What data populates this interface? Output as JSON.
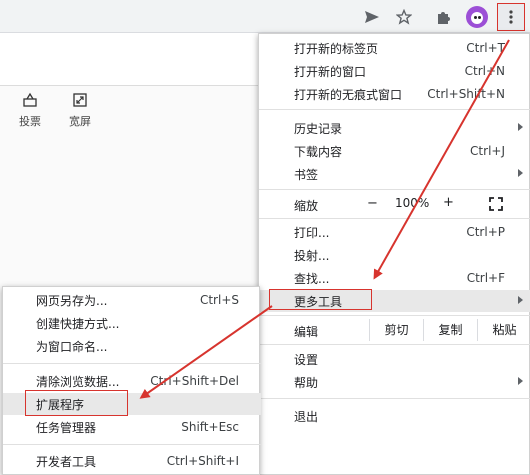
{
  "page": {
    "tools": [
      {
        "label": "投票",
        "icon": "vote-icon"
      },
      {
        "label": "宽屏",
        "icon": "widescreen-icon"
      }
    ]
  },
  "menu": {
    "items": [
      {
        "label": "打开新的标签页",
        "shortcut": "Ctrl+T"
      },
      {
        "label": "打开新的窗口",
        "shortcut": "Ctrl+N"
      },
      {
        "label": "打开新的无痕式窗口",
        "shortcut": "Ctrl+Shift+N"
      },
      {
        "label": "历史记录",
        "shortcut": ""
      },
      {
        "label": "下载内容",
        "shortcut": "Ctrl+J"
      },
      {
        "label": "书签",
        "shortcut": ""
      },
      {
        "label": "打印...",
        "shortcut": "Ctrl+P"
      },
      {
        "label": "投射...",
        "shortcut": ""
      },
      {
        "label": "查找...",
        "shortcut": "Ctrl+F"
      },
      {
        "label": "更多工具",
        "shortcut": ""
      },
      {
        "label": "设置",
        "shortcut": ""
      },
      {
        "label": "帮助",
        "shortcut": ""
      },
      {
        "label": "退出",
        "shortcut": ""
      }
    ],
    "zoom": {
      "label": "缩放",
      "minus": "−",
      "value": "100%",
      "plus": "+"
    },
    "edit": {
      "label": "编辑",
      "cut": "剪切",
      "copy": "复制",
      "paste": "粘贴"
    }
  },
  "submenu": {
    "items": [
      {
        "label": "网页另存为...",
        "shortcut": "Ctrl+S"
      },
      {
        "label": "创建快捷方式...",
        "shortcut": ""
      },
      {
        "label": "为窗口命名...",
        "shortcut": ""
      },
      {
        "label": "清除浏览数据...",
        "shortcut": "Ctrl+Shift+Del"
      },
      {
        "label": "扩展程序",
        "shortcut": ""
      },
      {
        "label": "任务管理器",
        "shortcut": "Shift+Esc"
      },
      {
        "label": "开发者工具",
        "shortcut": "Ctrl+Shift+I"
      }
    ]
  },
  "colors": {
    "annotation_red": "#d7342e",
    "avatar_purple": "#9c4fd6"
  }
}
